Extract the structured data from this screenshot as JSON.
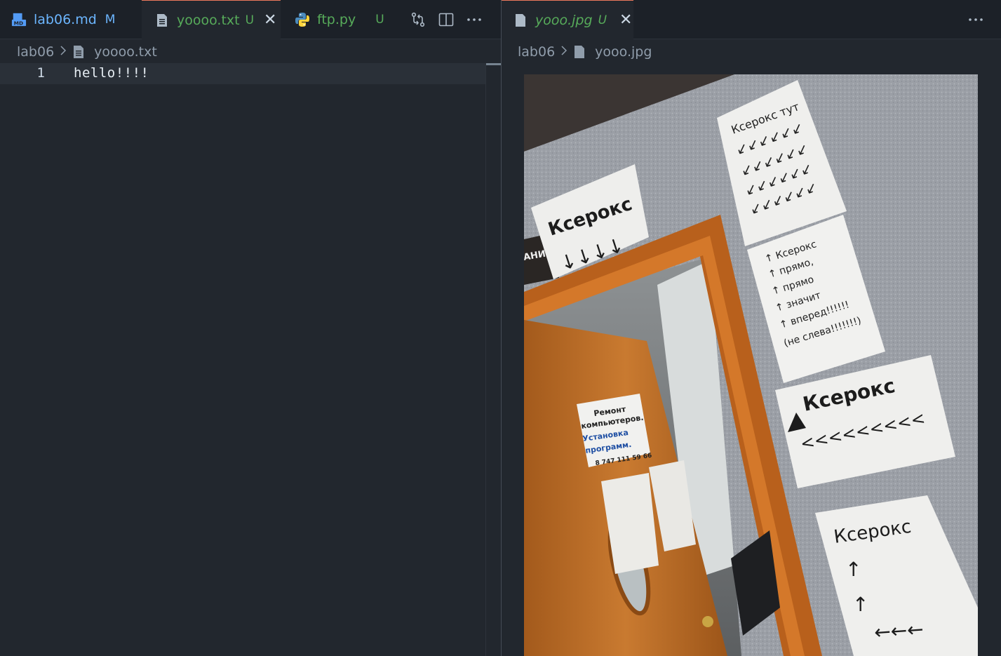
{
  "left_group": {
    "tabs": [
      {
        "label": "lab06.md",
        "badge": "M",
        "icon": "markdown-icon"
      },
      {
        "label": "yoooo.txt",
        "badge": "U",
        "icon": "text-file-icon",
        "active": true
      },
      {
        "label": "ftp.py",
        "badge": "U",
        "icon": "python-icon"
      }
    ],
    "actions": [
      "open-changes-icon",
      "split-editor-icon",
      "more-actions-icon"
    ],
    "breadcrumb": {
      "folder": "lab06",
      "file": "yoooo.txt"
    },
    "editor": {
      "lines": [
        {
          "number": "1",
          "text": "hello!!!!"
        }
      ]
    }
  },
  "right_group": {
    "tabs": [
      {
        "label": "yooo.jpg",
        "badge": "U",
        "icon": "image-file-icon",
        "active": true,
        "preview": true
      }
    ],
    "actions": [
      "more-actions-icon"
    ],
    "breadcrumb": {
      "folder": "lab06",
      "file": "yooo.jpg"
    },
    "image": {
      "signs": [
        "Ксерокс тут",
        "Ксерокс",
        "↑ Ксерокс",
        "↑ прямо,",
        "↑ прямо",
        "↑ значит",
        "↑ вперед!!!!!!",
        "(не слева!!!!!!!)",
        "Ксерокс",
        "<<<<<<<<<",
        "Ксерокс",
        "Ремонт компьютеров.",
        "Установка программ.",
        "8 747 111 59 66",
        "АНИЕ!"
      ]
    }
  },
  "colors": {
    "accent_active_tab": "#ec775c",
    "modified": "#6cb6ff",
    "untracked": "#57ab5a"
  }
}
